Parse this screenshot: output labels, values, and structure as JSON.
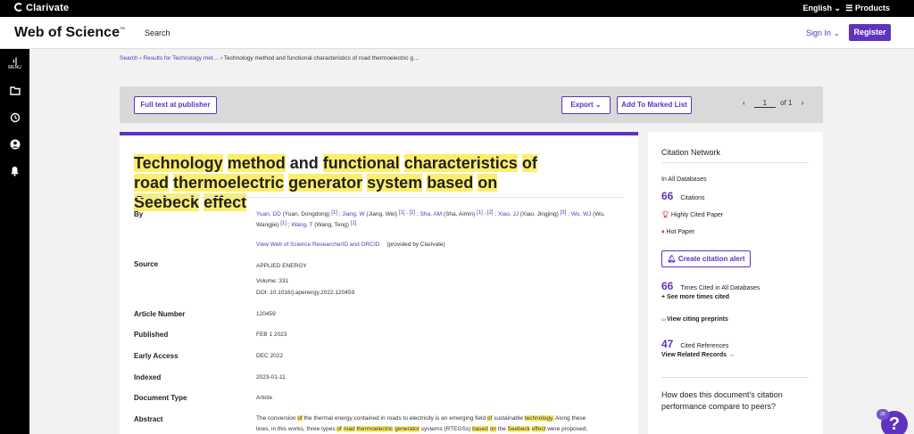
{
  "topbar": {
    "brand": "Clarivate",
    "language": "English ⌄",
    "products": "☰ Products"
  },
  "header": {
    "product": "Web of Science",
    "tm": "™",
    "search": "Search",
    "sign_in": "Sign In ⌄",
    "register": "Register"
  },
  "sidebar": {
    "menu_arrow": "›|",
    "menu": "MENU"
  },
  "breadcrumb": {
    "search": "Search",
    "results": "Results for Technology met…",
    "current": "Technology method and functional characteristics of road thermoelectric g…"
  },
  "toolbar": {
    "full_text": "Full text at publisher",
    "export": "Export ⌄",
    "add_marked": "Add To Marked List",
    "page": "1",
    "of_pages": "of 1"
  },
  "record": {
    "title_parts": [
      "Technology",
      " ",
      "method",
      " and ",
      "functional",
      " ",
      "characteristics",
      " ",
      "of",
      " ",
      "road",
      " ",
      "thermoelectric",
      " ",
      "generator",
      " ",
      "system",
      " ",
      "based",
      " ",
      "on",
      " ",
      "Seebeck",
      " ",
      "effect"
    ],
    "labels": {
      "by": "By",
      "source": "Source",
      "article_number": "Article Number",
      "published": "Published",
      "early_access": "Early Access",
      "indexed": "Indexed",
      "document_type": "Document Type",
      "abstract": "Abstract"
    },
    "authors": [
      {
        "link": "Yuan, DD",
        "full": " (Yuan, Dongdong) ",
        "refs": "[1]"
      },
      {
        "link": "Jiang, W",
        "full": " (Jiang, Wei) ",
        "refs": "[1] , [2]"
      },
      {
        "link": "Sha, AM",
        "full": " (Sha, Aimin) ",
        "refs": "[1] , [2]"
      },
      {
        "link": "Xiao, JJ",
        "full": " (Xiao, Jingjing) ",
        "refs": "[3]"
      },
      {
        "link": "Wu, WJ",
        "full": " (Wu, Wangjie) ",
        "refs": "[1]"
      },
      {
        "link": "Wang, T",
        "full": " (Wang, Teng) ",
        "refs": "[1]"
      }
    ],
    "researcher_link": "View Web of Science ResearcherID and ORCID",
    "provided_by": "(provided by Clarivate)",
    "source_journal": "APPLIED ENERGY",
    "volume": "Volume: 331",
    "doi": "DOI: 10.1016/j.apenergy.2022.120459",
    "article_number": "120459",
    "published": "FEB 1 2023",
    "early_access": "DEC 2022",
    "indexed": "2023-01-11",
    "document_type": "Article",
    "abstract_line1": "The conversion of the thermal energy contained in roads to electricity is an emerging field of sustainable technology. Along these",
    "abstract_line2": "lines, in this works, three types of road thermoelectric generator systems (RTEGSs) based on the Seebeck effect were proposed,"
  },
  "citation_network": {
    "heading": "Citation Network",
    "in_all_db": "In All Databases",
    "citations_count": "66",
    "citations_label": "Citations",
    "highly_cited": "Highly Cited Paper",
    "hot_paper": "Hot Paper",
    "create_alert": "Create citation alert",
    "times_cited_count": "66",
    "times_cited_label": "Times Cited in All Databases",
    "see_more": "See more times cited",
    "view_preprints": "View citing preprints",
    "cited_refs_count": "47",
    "cited_refs_label": "Cited References",
    "view_related": "View Related Records →",
    "question": "How does this document's citation performance compare to peers?"
  },
  "help": {
    "badge": "26",
    "icon": "?"
  },
  "colors": {
    "accent": "#5e33bf",
    "highlight": "#fbee6e"
  }
}
